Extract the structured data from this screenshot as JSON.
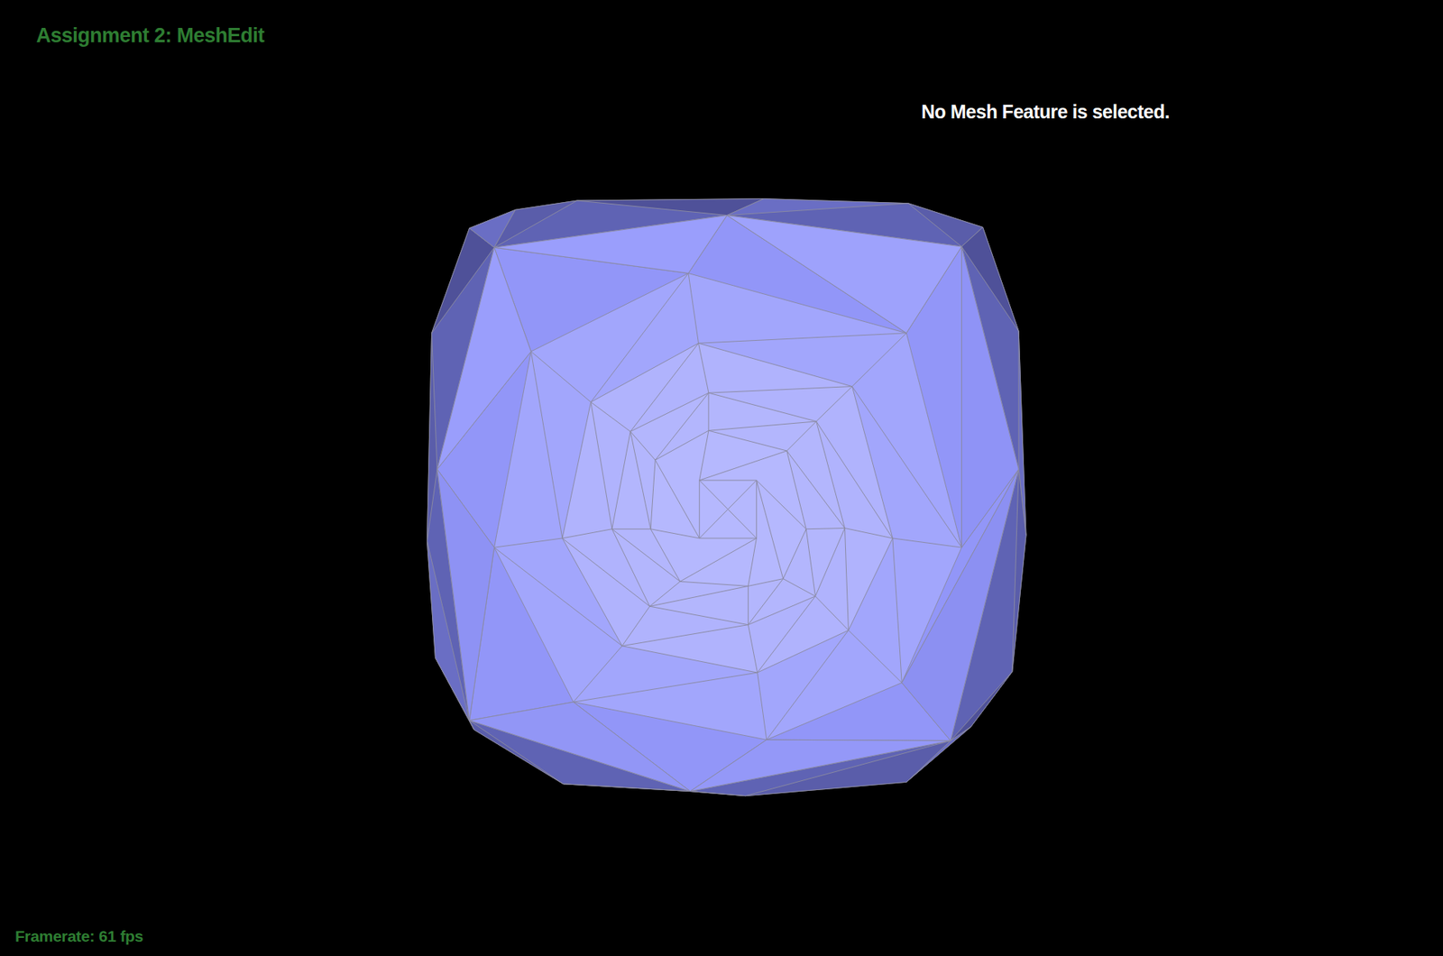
{
  "header": {
    "title": "Assignment 2: MeshEdit"
  },
  "status": {
    "message": "No Mesh Feature is selected."
  },
  "footer": {
    "framerate": "Framerate: 61 fps"
  }
}
